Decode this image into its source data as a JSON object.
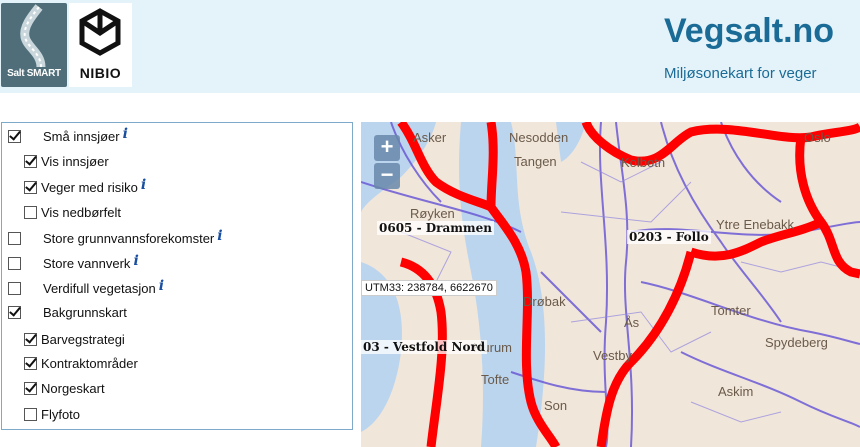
{
  "header": {
    "logo_saltsmart": "Salt SMART",
    "logo_nibio": "NIBIO",
    "title": "Vegsalt.no",
    "subtitle": "Miljøsonekart for veger"
  },
  "layers": [
    {
      "label": "Små innsjøer",
      "checked": true,
      "info": "i"
    },
    {
      "label": "Vis innsjøer",
      "checked": true
    },
    {
      "label": "Veger med risiko",
      "checked": true,
      "info": "i"
    },
    {
      "label": "Vis nedbørfelt",
      "checked": false
    },
    {
      "label": "Store grunnvannsforekomster",
      "checked": false,
      "info": "i"
    },
    {
      "label": "Store vannverk",
      "checked": false,
      "info": "i"
    },
    {
      "label": "Verdifull vegetasjon",
      "checked": false,
      "info": "i"
    },
    {
      "label": "Bakgrunnskart",
      "checked": true
    },
    {
      "label": "Barvegstrategi",
      "checked": true
    },
    {
      "label": "Kontraktområder",
      "checked": true
    },
    {
      "label": "Norgeskart",
      "checked": true
    },
    {
      "label": "Flyfoto",
      "checked": false
    }
  ],
  "map": {
    "zoom_in": "+",
    "zoom_out": "−",
    "contract_labels": [
      "0605 - Drammen",
      "0203 - Follo",
      "03 - Vestfold Nord"
    ],
    "coordinate_readout": "UTM33: 238784, 6622670",
    "place_names": [
      "Røyken",
      "Asker",
      "Drøbak",
      "Hurum",
      "Tofte",
      "Son",
      "Vestby",
      "Ås",
      "Kolbotn",
      "Ytre Enebakk",
      "Tomter",
      "Spydeberg",
      "Askim",
      "Oslo",
      "Nesodden",
      "Tangen"
    ],
    "colors": {
      "boundary": "#ff0000",
      "roads": "#6a5ad6",
      "water": "#bcd5ee",
      "land": "#f1e6da"
    }
  }
}
